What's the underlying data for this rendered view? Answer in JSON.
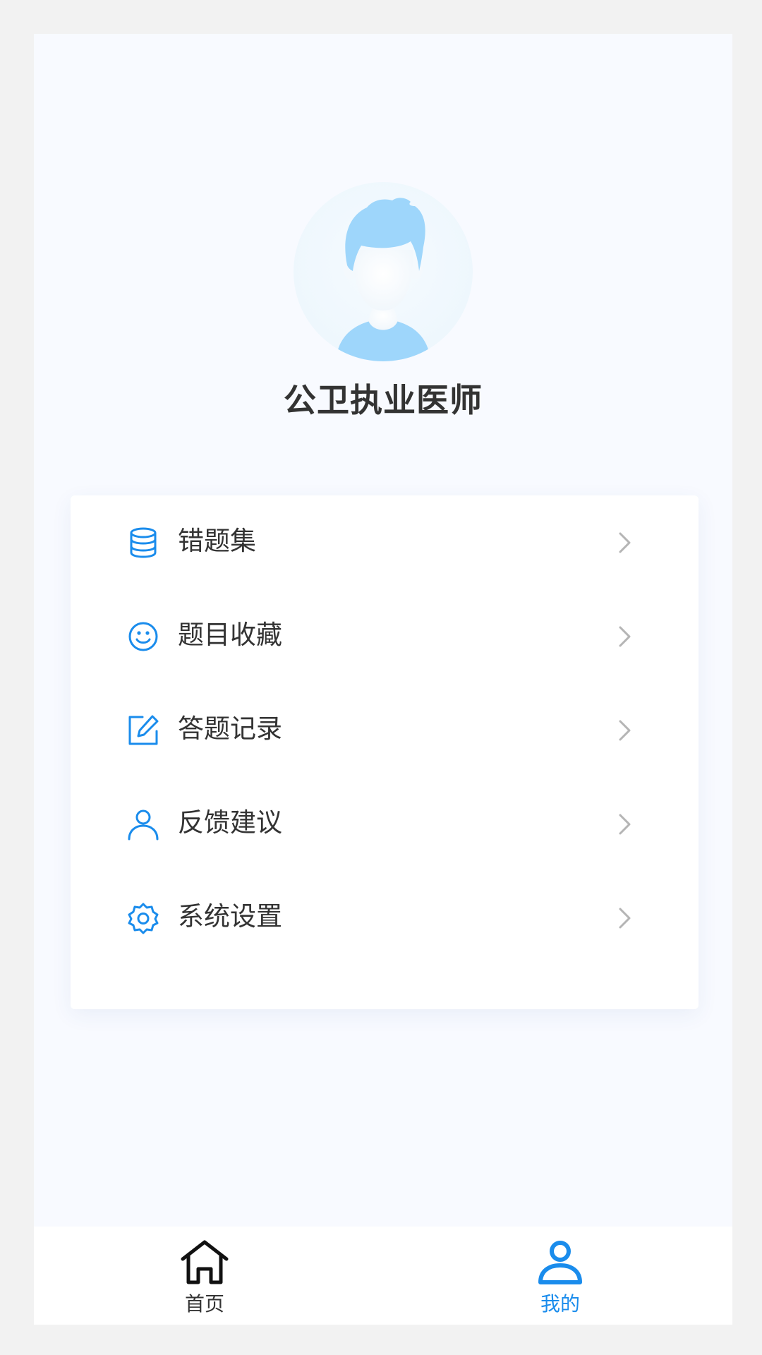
{
  "profile": {
    "name": "公卫执业医师",
    "avatar_icon": "user-avatar-illustration"
  },
  "menu": {
    "items": [
      {
        "label": "错题集",
        "icon": "database-icon"
      },
      {
        "label": "题目收藏",
        "icon": "smiley-icon"
      },
      {
        "label": "答题记录",
        "icon": "edit-icon"
      },
      {
        "label": "反馈建议",
        "icon": "person-icon"
      },
      {
        "label": "系统设置",
        "icon": "gear-icon"
      }
    ],
    "chevron_icon": "chevron-right-icon"
  },
  "tabbar": {
    "tabs": [
      {
        "label": "首页",
        "icon": "home-icon",
        "active": false
      },
      {
        "label": "我的",
        "icon": "person-icon",
        "active": true
      }
    ]
  },
  "colors": {
    "accent": "#1a8cec",
    "text": "#333333",
    "chevron": "#b5b5b5",
    "avatar": "#9ed6fb",
    "background": "#f8faff"
  }
}
